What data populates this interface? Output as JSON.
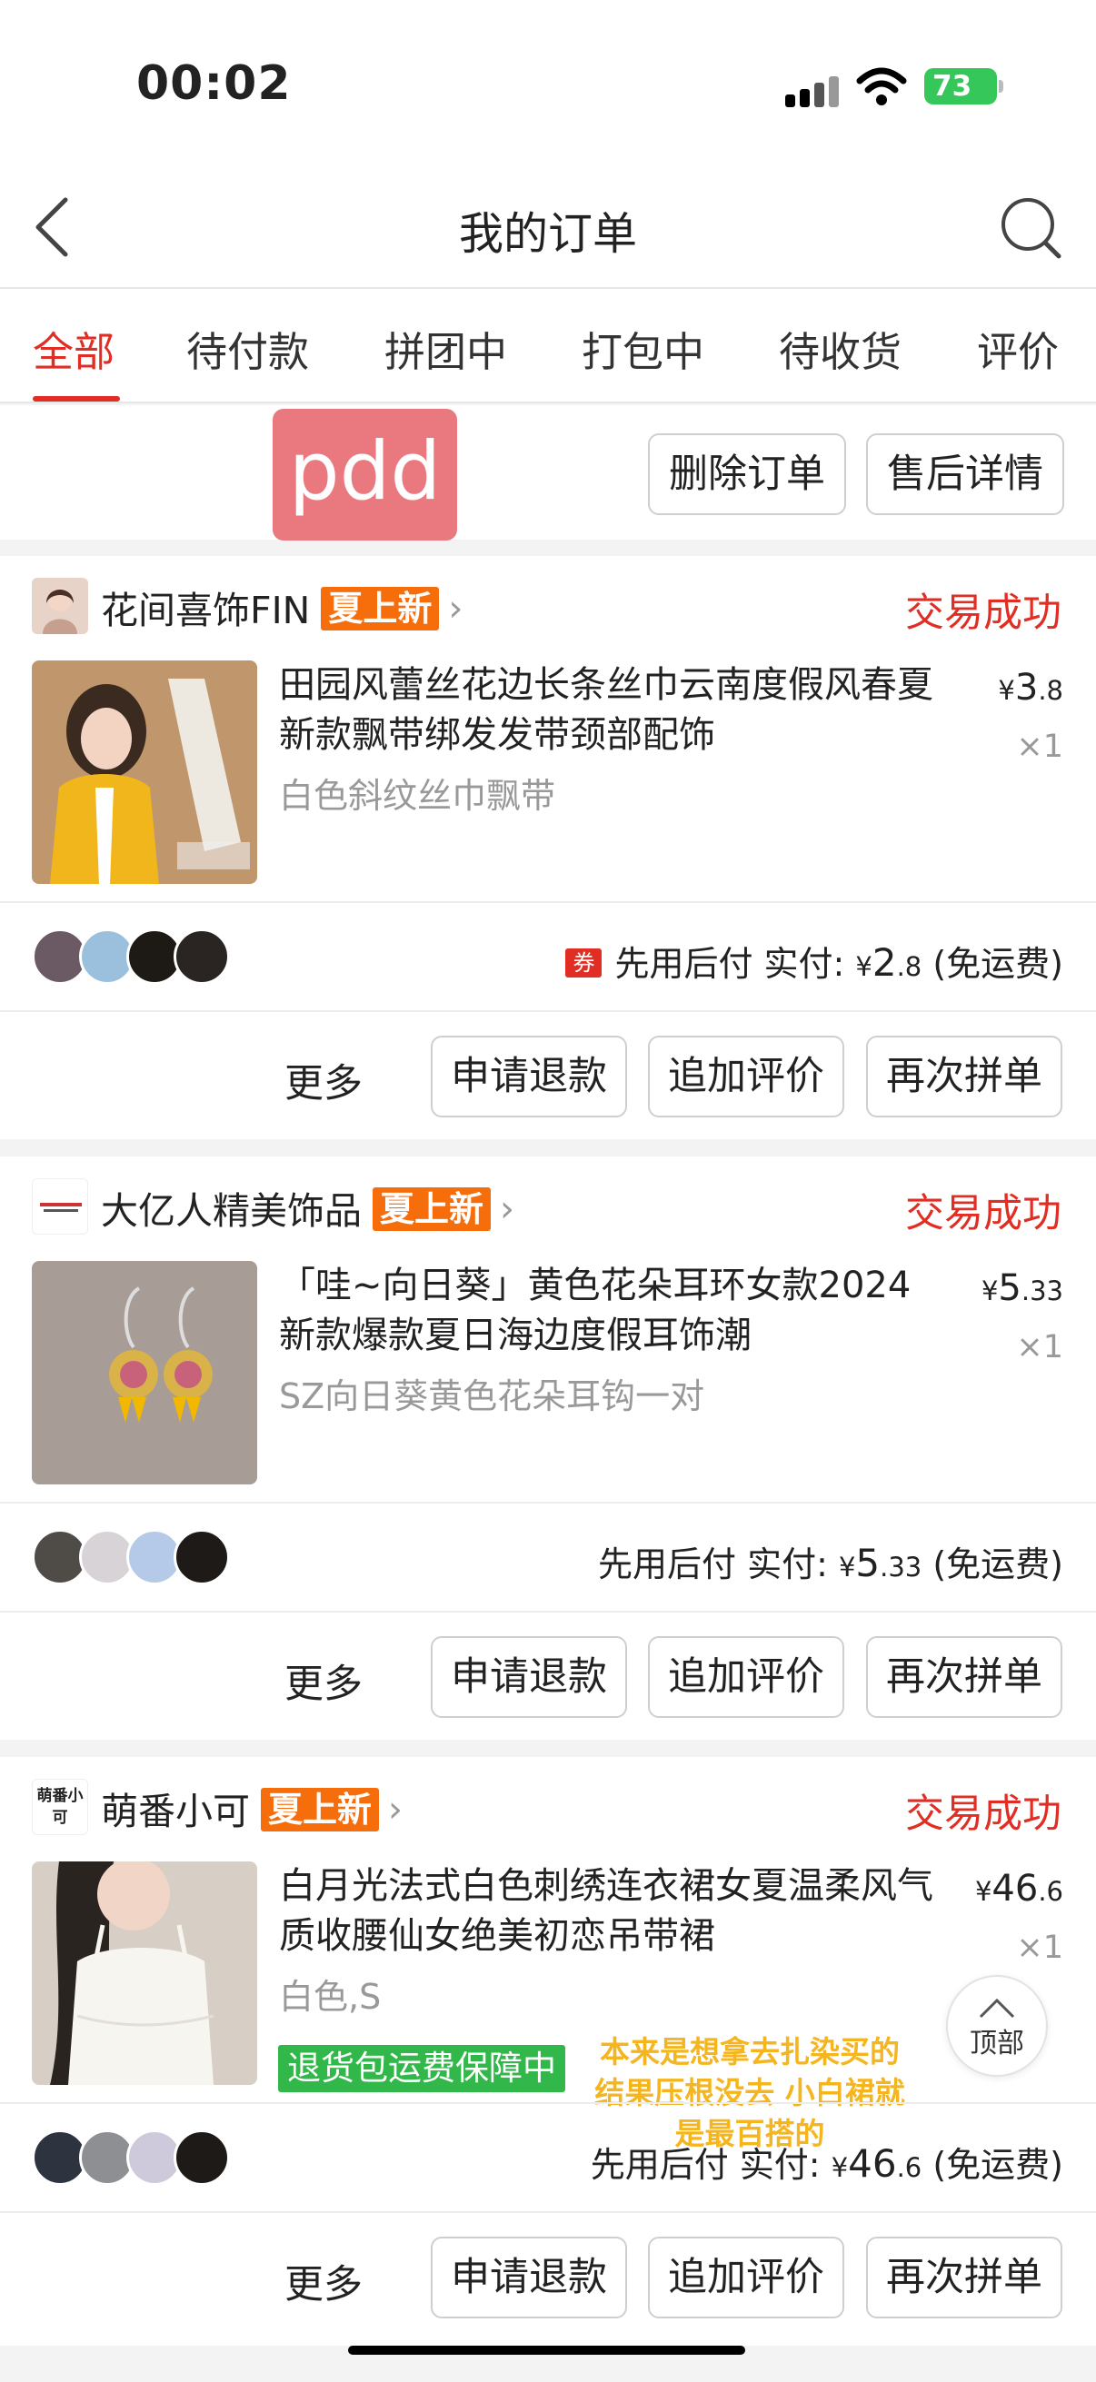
{
  "status_bar": {
    "time": "00:02",
    "battery": "73"
  },
  "header": {
    "title": "我的订单",
    "back_icon": "chevron-left-icon",
    "search_icon": "search-icon"
  },
  "tabs": [
    {
      "label": "全部",
      "active": true
    },
    {
      "label": "待付款"
    },
    {
      "label": "拼团中"
    },
    {
      "label": "打包中"
    },
    {
      "label": "待收货"
    },
    {
      "label": "评价"
    }
  ],
  "toolbar": {
    "logo": "pdd",
    "delete_orders": "删除订单",
    "after_sale": "售后详情"
  },
  "orders": [
    {
      "store": "花间喜饰FIN",
      "badge": "夏上新",
      "status": "交易成功",
      "product": "田园风蕾丝花边长条丝巾云南度假风春夏新款飘带绑发发带颈部配饰",
      "spec": "白色斜纹丝巾飘带",
      "price_symbol": "¥",
      "price_int": "3",
      "price_dec": ".8",
      "qty": "×1",
      "coupon": "券",
      "payment_label": "先用后付 实付: ",
      "paid_symbol": "¥",
      "paid_int": "2",
      "paid_dec": ".8",
      "shipping": " (免运费)",
      "actions": {
        "more": "更多",
        "refund": "申请退款",
        "review": "追加评价",
        "rebuy": "再次拼单"
      }
    },
    {
      "store": "大亿人精美饰品",
      "badge": "夏上新",
      "status": "交易成功",
      "product": "「哇~向日葵」黄色花朵耳环女款2024新款爆款夏日海边度假耳饰潮",
      "spec": "SZ向日葵黄色花朵耳钩一对",
      "price_symbol": "¥",
      "price_int": "5",
      "price_dec": ".33",
      "qty": "×1",
      "payment_label": "先用后付 实付: ",
      "paid_symbol": "¥",
      "paid_int": "5",
      "paid_dec": ".33",
      "shipping": " (免运费)",
      "actions": {
        "more": "更多",
        "refund": "申请退款",
        "review": "追加评价",
        "rebuy": "再次拼单"
      }
    },
    {
      "store": "萌番小可",
      "store_avatar_text": "萌番小可",
      "badge": "夏上新",
      "status": "交易成功",
      "product": "白月光法式白色刺绣连衣裙女夏温柔风气质收腰仙女绝美初恋吊带裙",
      "spec": "白色,S",
      "price_symbol": "¥",
      "price_int": "46",
      "price_dec": ".6",
      "qty": "×1",
      "guarantee": "退货包运费保障中",
      "note": "本来是想拿去扎染买的 结果压根没去 小白裙就是最百搭的",
      "payment_label": "先用后付 实付: ",
      "paid_symbol": "¥",
      "paid_int": "46",
      "paid_dec": ".6",
      "shipping": " (免运费)",
      "actions": {
        "more": "更多",
        "refund": "申请退款",
        "review": "追加评价",
        "rebuy": "再次拼单"
      }
    }
  ],
  "floating": {
    "top_label": "顶部"
  },
  "colors": {
    "accent": "#e02e24",
    "badge": "#f66d0c",
    "guarantee": "#32b84a"
  }
}
